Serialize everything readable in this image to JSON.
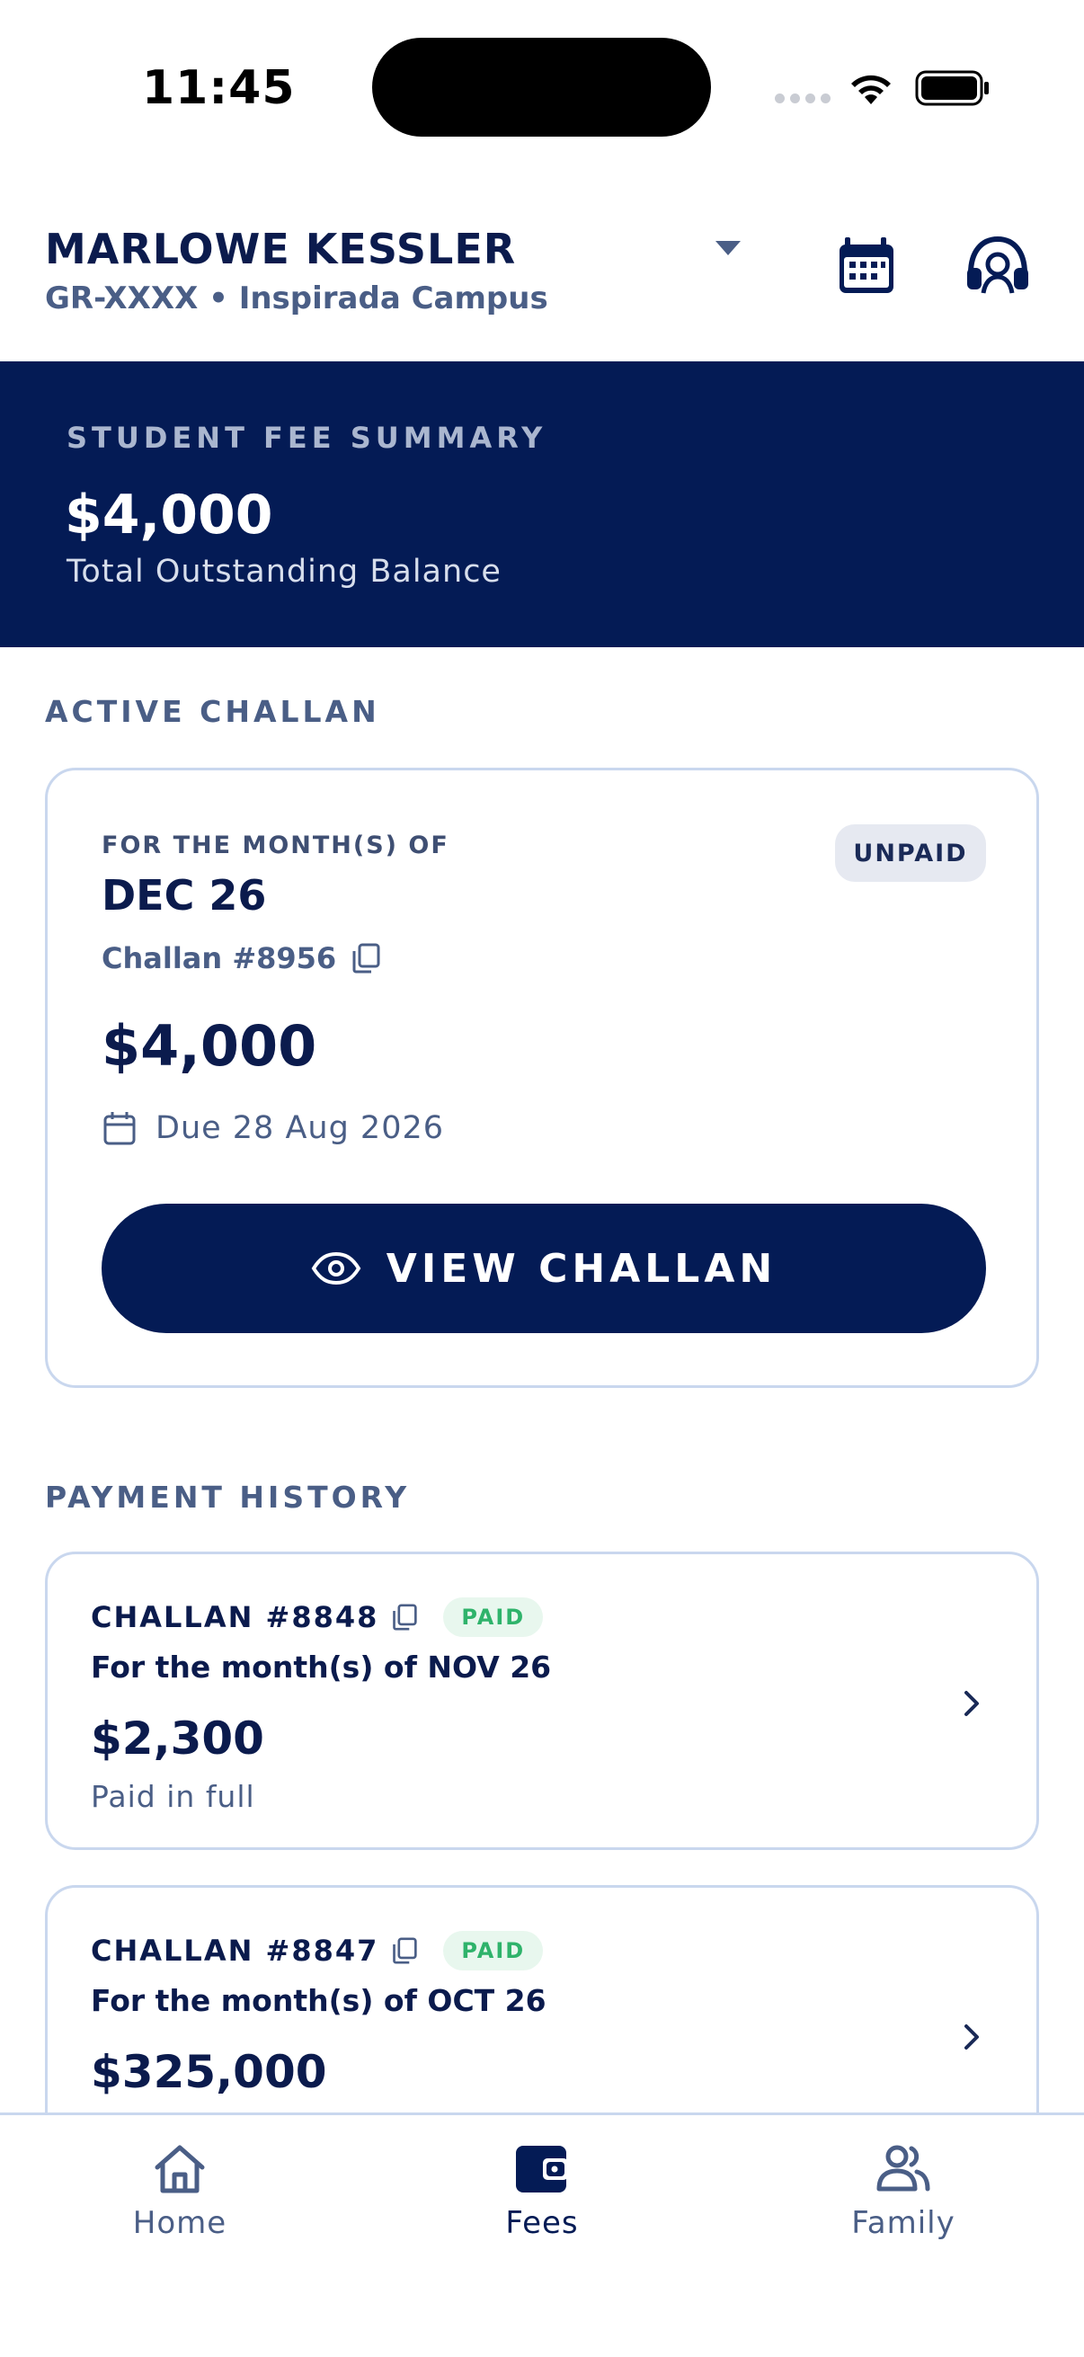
{
  "status_bar": {
    "time": "11:45"
  },
  "header": {
    "student_name": "MARLOWE KESSLER",
    "student_sub": "GR-XXXX • Inspirada Campus"
  },
  "summary": {
    "label": "STUDENT FEE SUMMARY",
    "amount": "$4,000",
    "caption": "Total Outstanding Balance"
  },
  "active_section": {
    "title": "ACTIVE CHALLAN",
    "month_label": "FOR THE MONTH(S) OF",
    "month": "DEC 26",
    "challan_number": "Challan #8956",
    "amount": "$4,000",
    "due": "Due 28 Aug 2026",
    "status": "UNPAID",
    "button_label": "VIEW CHALLAN"
  },
  "history": {
    "title": "PAYMENT HISTORY",
    "items": [
      {
        "number": "CHALLAN #8848",
        "status": "PAID",
        "month": "For the month(s) of NOV 26",
        "amount": "$2,300",
        "note": "Paid in full"
      },
      {
        "number": "CHALLAN #8847",
        "status": "PAID",
        "month": "For the month(s) of OCT 26",
        "amount": "$325,000",
        "note": ""
      }
    ]
  },
  "nav": {
    "items": [
      {
        "label": "Home",
        "icon": "home-icon",
        "active": false
      },
      {
        "label": "Fees",
        "icon": "wallet-icon",
        "active": true
      },
      {
        "label": "Family",
        "icon": "family-icon",
        "active": false
      }
    ]
  },
  "colors": {
    "primary": "#041b55",
    "text": "#0b1b4d",
    "muted": "#4a5e86",
    "card_border": "#c9d7ee",
    "paid": "#2fb36b",
    "paid_bg": "#e8f7ee",
    "unpaid_bg": "#e6e9f1"
  }
}
